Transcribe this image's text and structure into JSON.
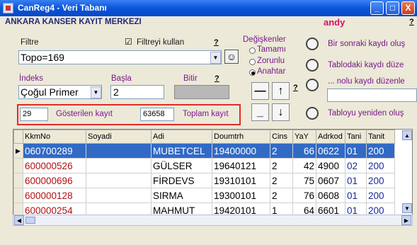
{
  "window": {
    "title": "CanReg4 - Veri Tabanı",
    "min": "_",
    "max": "□",
    "close": "X"
  },
  "header": {
    "org": "ANKARA KANSER KAYIT MERKEZI",
    "user": "andy",
    "help": "?"
  },
  "filter": {
    "label": "Filtre",
    "use_label": "Filtreyi kullan",
    "use_checked": "☑",
    "help": "?",
    "value": "Topo=169",
    "dropdown": "▼",
    "smiley": "☺"
  },
  "index": {
    "label": "İndeks",
    "start_label": "Başla",
    "end_label": "Bitir",
    "help": "?",
    "value": "Çoğul Primer",
    "dropdown": "▼",
    "start_value": "2"
  },
  "counts": {
    "shown": "29",
    "shown_label": "Gösterilen kayıt",
    "total": "63658",
    "total_label": "Toplam kayıt"
  },
  "variables": {
    "label": "Değişkenler",
    "options": [
      "Tamamı",
      "Zorunlu",
      "Anahtar"
    ],
    "help": "?"
  },
  "nav": {
    "dash1": "—",
    "up": "↑",
    "dash2": "_",
    "down": "↓"
  },
  "actions": {
    "next": "Bir sonraki kaydı oluş",
    "edit_table": "Tablodaki kaydı düze",
    "edit_numbered": "... nolu kaydı düzenle",
    "recreate": "Tabloyu yeniden oluş"
  },
  "table": {
    "columns": [
      "KkmNo",
      "Soyadi",
      "Adi",
      "Doumtrh",
      "Cins",
      "YaY",
      "Adrkod",
      "Tani",
      "Tanit"
    ],
    "rows": [
      [
        "060700289",
        "",
        "MUBETCEL",
        "19400000",
        "2",
        "66",
        "0622",
        "01",
        "200"
      ],
      [
        "600000526",
        "",
        "GÜLSER",
        "19640121",
        "2",
        "42",
        "4900",
        "02",
        "200"
      ],
      [
        "600000696",
        "",
        "FİRDEVS",
        "19310101",
        "2",
        "75",
        "0607",
        "01",
        "200"
      ],
      [
        "600000128",
        "",
        "SIRMA",
        "19300101",
        "2",
        "76",
        "0608",
        "01",
        "200"
      ],
      [
        "600000254",
        "",
        "MAHMUT",
        "19420101",
        "1",
        "64",
        "6601",
        "01",
        "200"
      ]
    ],
    "scroll_left": "◀",
    "scroll_right": "▶",
    "scroll_up": "▲",
    "scroll_down": "▼"
  },
  "colors": {
    "kkm_red": "#b01010",
    "tani_blue": "#1a2a9a",
    "selection": "#316ac5"
  }
}
